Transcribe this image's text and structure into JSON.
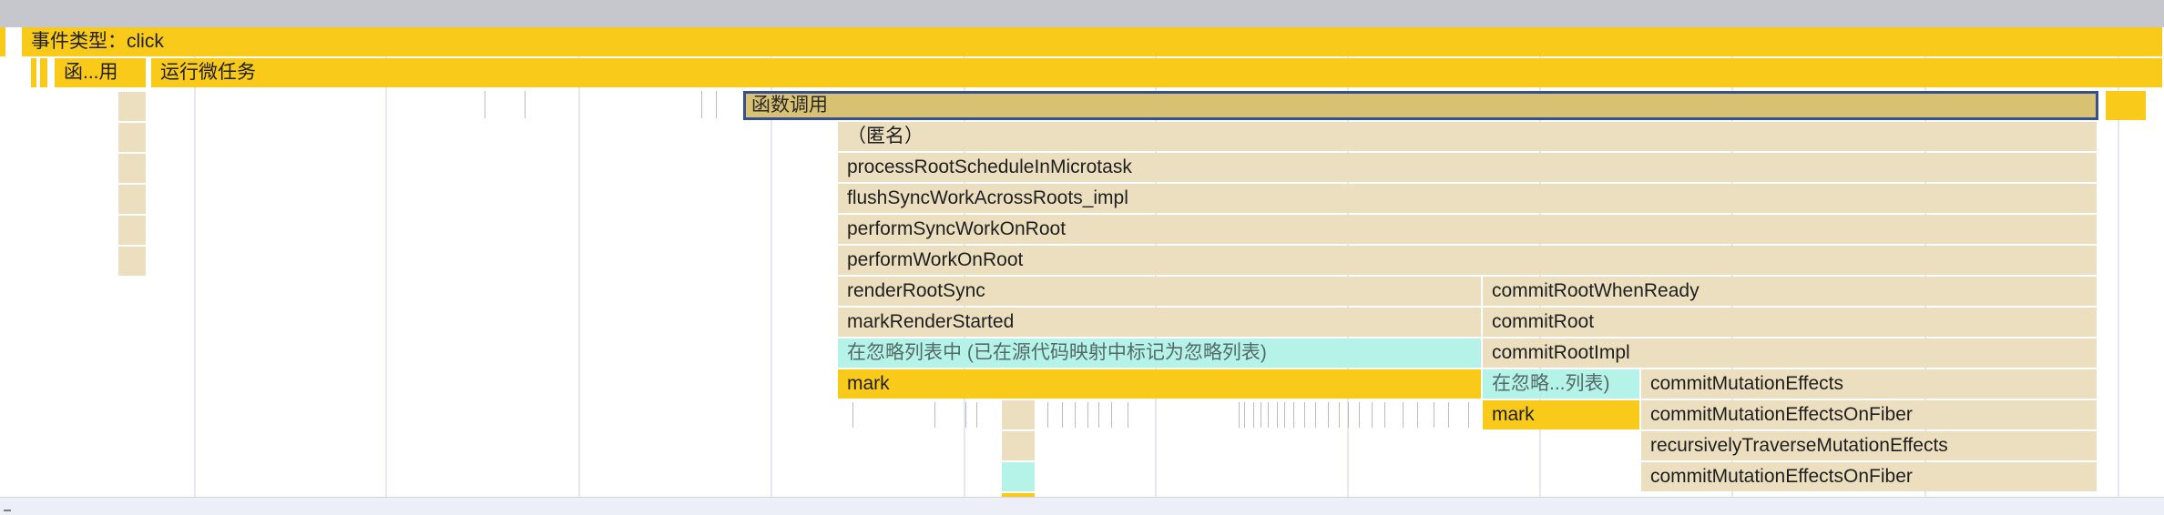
{
  "flame": {
    "event_type_label": "事件类型：click",
    "function_call_truncated": "函...用",
    "run_microtasks": "运行微任务",
    "function_call": "函数调用",
    "anonymous": "（匿名）",
    "frames": {
      "process_root_schedule": "processRootScheduleInMicrotask",
      "flush_sync_work": "flushSyncWorkAcrossRoots_impl",
      "perform_sync_work": "performSyncWorkOnRoot",
      "perform_work": "performWorkOnRoot",
      "render_root_sync": "renderRootSync",
      "mark_render_started": "markRenderStarted",
      "ignore_list_full": "在忽略列表中 (已在源代码映射中标记为忽略列表)",
      "mark_left": "mark",
      "commit_root_when_ready": "commitRootWhenReady",
      "commit_root": "commitRoot",
      "commit_root_impl": "commitRootImpl",
      "ignore_list_truncated": "在忽略...列表)",
      "mark_right": "mark",
      "commit_mutation_effects": "commitMutationEffects",
      "commit_mutation_effects_on_fiber_1": "commitMutationEffectsOnFiber",
      "recursively_traverse": "recursivelyTraverseMutationEffects",
      "commit_mutation_effects_on_fiber_2": "commitMutationEffectsOnFiber"
    }
  },
  "colors": {
    "scripting_yellow": "#f9ca1a",
    "ignored_tan": "#ecdfbf",
    "ignore_list_cyan": "#b5f3e8",
    "selected_fill": "#d9c172",
    "selection_border": "#35508f"
  }
}
